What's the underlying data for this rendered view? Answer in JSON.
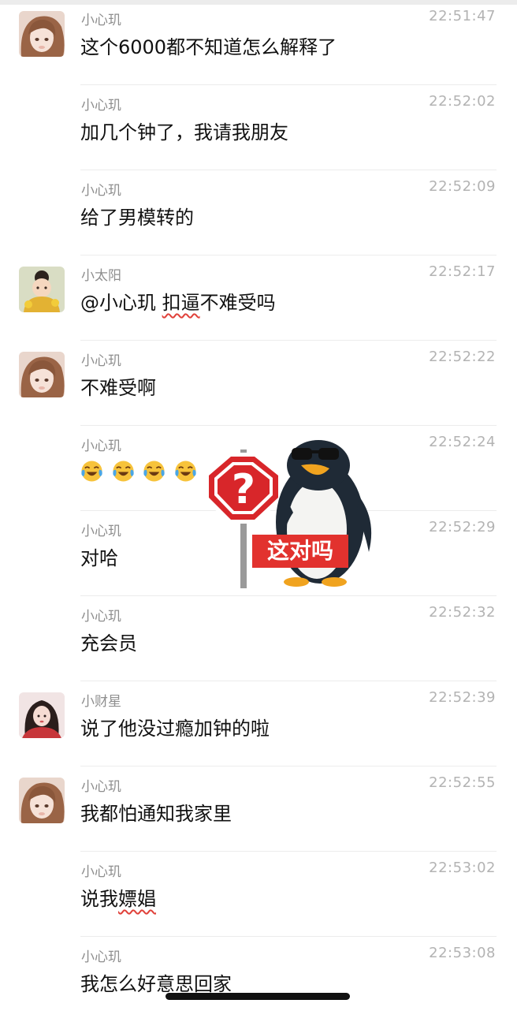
{
  "messages": [
    {
      "sender": "小心玑",
      "time": "22:51:47",
      "text": "这个6000都不知道怎么解释了",
      "avatar": "avatar-brown-hair-girl"
    },
    {
      "sender": "小心玑",
      "time": "22:52:02",
      "text": "加几个钟了，我请我朋友"
    },
    {
      "sender": "小心玑",
      "time": "22:52:09",
      "text": "给了男模转的"
    },
    {
      "sender": "小太阳",
      "time": "22:52:17",
      "mention": "@小心玑 ",
      "marked": "扣逼",
      "rest": "不难受吗",
      "avatar": "avatar-child-with-flowers"
    },
    {
      "sender": "小心玑",
      "time": "22:52:22",
      "text": "不难受啊",
      "avatar": "avatar-brown-hair-girl"
    },
    {
      "sender": "小心玑",
      "time": "22:52:24",
      "emojis": [
        "crying-laughing",
        "crying-laughing",
        "crying-laughing",
        "crying-laughing"
      ]
    },
    {
      "sender": "小心玑",
      "time": "22:52:29",
      "text": "对哈"
    },
    {
      "sender": "小心玑",
      "time": "22:52:32",
      "text": "充会员"
    },
    {
      "sender": "小财星",
      "time": "22:52:39",
      "text": "说了他没过瘾加钟的啦",
      "avatar": "avatar-dark-hair-girl"
    },
    {
      "sender": "小心玑",
      "time": "22:52:55",
      "text": "我都怕通知我家里",
      "avatar": "avatar-brown-hair-girl"
    },
    {
      "sender": "小心玑",
      "time": "22:53:02",
      "prefix": "说我",
      "marked": "嫖娼"
    },
    {
      "sender": "小心玑",
      "time": "22:53:08",
      "text": "我怎么好意思回家"
    }
  ],
  "sticker": {
    "sign_text": "这对吗",
    "icon": "question-stop-sign-penguin-sunglasses"
  },
  "colors": {
    "accent_red": "#e0413a",
    "sender_gray": "#8e8e8e",
    "time_gray": "#b3b3b3"
  }
}
